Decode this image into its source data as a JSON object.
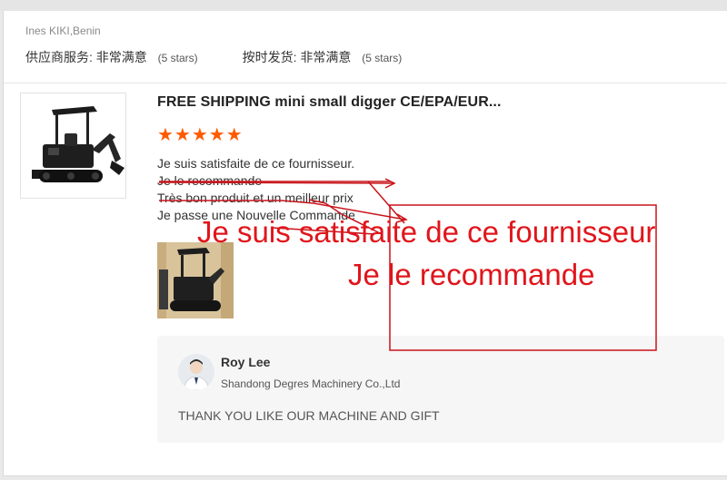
{
  "review": {
    "reviewer": "Ines KIKI,Benin",
    "ratings": [
      {
        "label": "供应商服务:",
        "value": "非常满意",
        "note": "(5 stars)"
      },
      {
        "label": "按时发货:",
        "value": "非常满意",
        "note": "(5 stars)"
      }
    ],
    "product_title": "FREE SHIPPING mini small digger CE/EPA/EUR...",
    "stars": "★★★★★",
    "rating_fraction": 1.0,
    "lines": [
      "Je suis satisfaite de ce fournisseur.",
      "Je le recommande",
      "Très bon produit et un meilleur prix",
      "Je passe une Nouvelle Commande"
    ]
  },
  "reply": {
    "name": "Roy Lee",
    "company": "Shandong Degres Machinery Co.,Ltd",
    "text": "THANK YOU LIKE OUR MACHINE AND GIFT"
  },
  "annotation": {
    "line1": "Je suis satisfaite de ce fournisseur",
    "line2": "Je le recommande",
    "color": "#e0151b"
  }
}
